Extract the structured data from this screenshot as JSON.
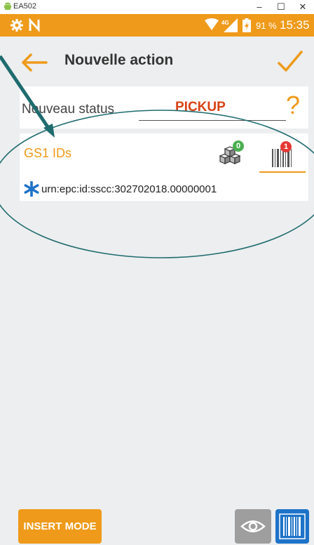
{
  "window": {
    "title": "EA502",
    "minimize_icon": "minimize-icon",
    "maximize_icon": "maximize-icon",
    "close_icon": "close-icon"
  },
  "status_bar": {
    "battery": "91 %",
    "time": "15:35",
    "network": "4G",
    "background_color": "#ef9a1a"
  },
  "app_bar": {
    "title": "Nouvelle action",
    "back_icon": "arrow-left-icon",
    "confirm_icon": "checkmark-icon"
  },
  "status_field": {
    "label": "Nouveau status",
    "value": "PICKUP",
    "help_symbol": "?"
  },
  "gs1": {
    "title": "GS1 IDs",
    "boxes_count": "0",
    "barcode_count": "1",
    "items": [
      {
        "marker_icon": "asterisk-icon",
        "urn": "urn:epc:id:sscc:302702018.00000001"
      }
    ]
  },
  "bottom_bar": {
    "insert_mode_label": "INSERT MODE",
    "view_icon": "eye-icon",
    "scan_icon": "barcode-icon"
  },
  "colors": {
    "accent": "#ef9a1a",
    "status_value": "#d84315",
    "scan_button": "#1e73c8",
    "annotation": "#1e6b6e"
  }
}
